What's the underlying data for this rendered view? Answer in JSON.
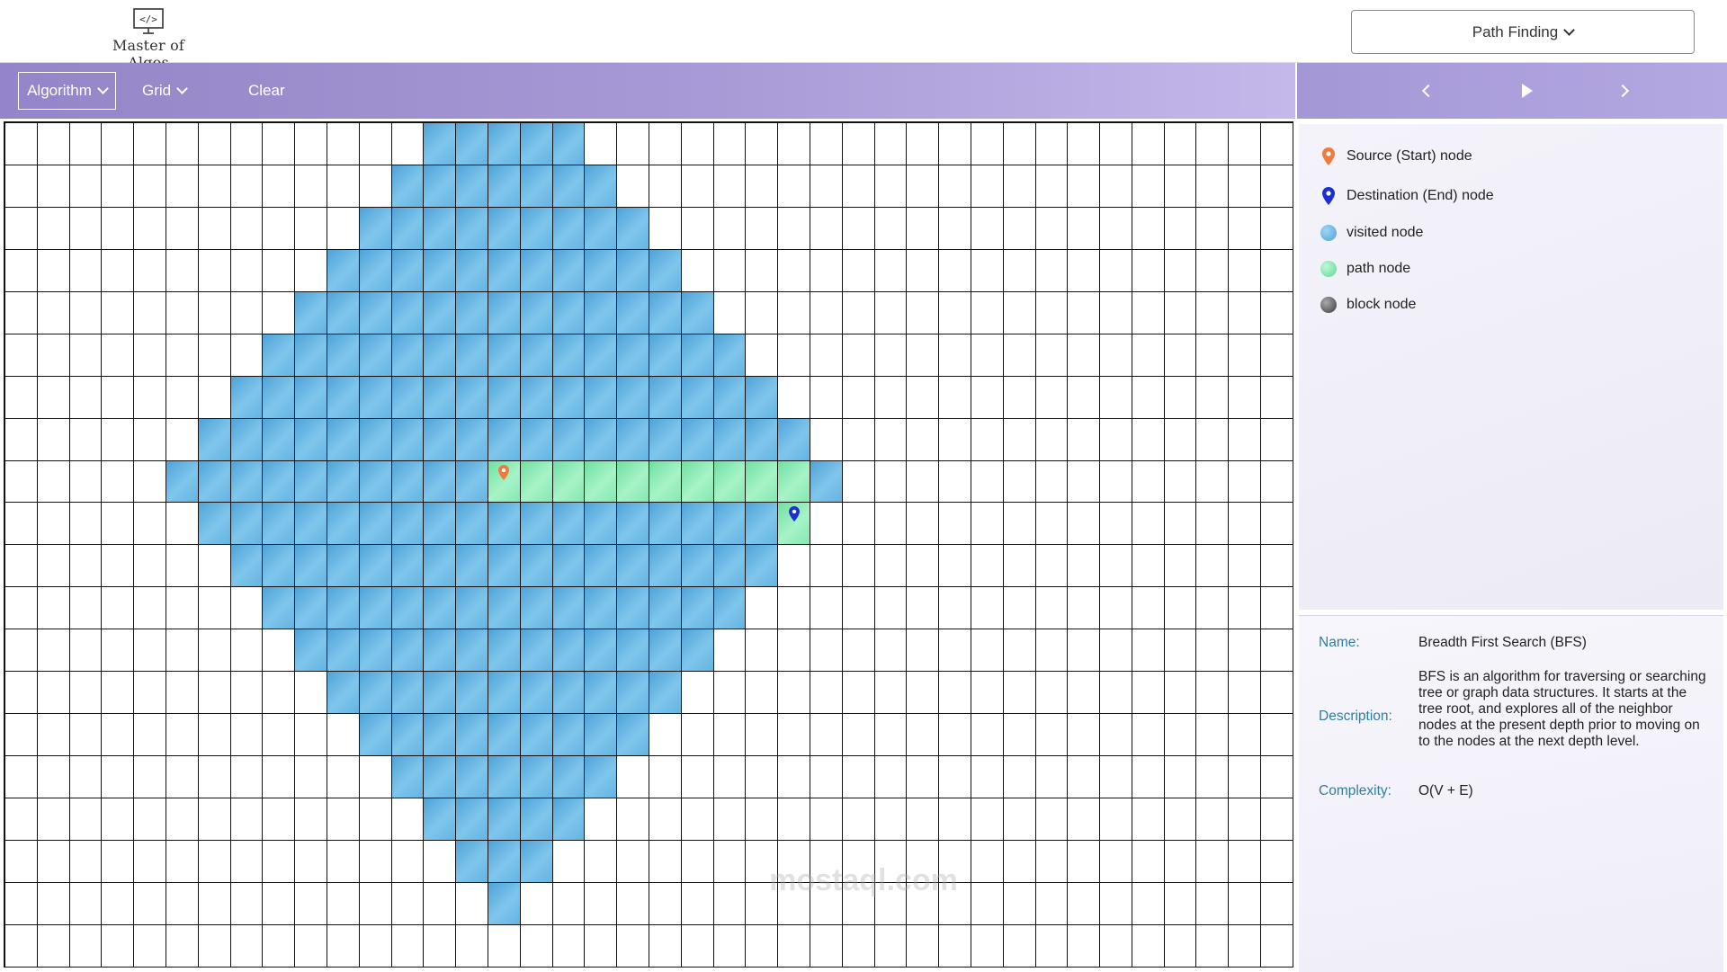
{
  "header": {
    "logo_text": "Master of Algos",
    "mode_label": "Path Finding"
  },
  "toolbar": {
    "algorithm_label": "Algorithm",
    "grid_label": "Grid",
    "clear_label": "Clear"
  },
  "controls": {
    "prev_icon": "chevron-left-icon",
    "play_icon": "play-icon",
    "next_icon": "chevron-right-icon"
  },
  "legend": {
    "items": [
      {
        "label": "Source (Start) node",
        "icon": "map-pin-icon",
        "color": "#f07a3c"
      },
      {
        "label": "Destination (End) node",
        "icon": "map-pin-icon",
        "color": "#1a2fd6"
      },
      {
        "label": "visited node",
        "icon": "dot-icon",
        "color": "#5fb1e2"
      },
      {
        "label": "path node",
        "icon": "dot-icon",
        "color": "#6fe3a3"
      },
      {
        "label": "block node",
        "icon": "dot-icon",
        "color": "#555555"
      }
    ]
  },
  "info": {
    "name_label": "Name:",
    "name_value": "Breadth First Search (BFS)",
    "description_label": "Description:",
    "description_value": "BFS is an algorithm for traversing or searching tree or graph data structures. It starts at the tree root, and explores all of the neighbor nodes at the present depth prior to moving on to the nodes at the next depth level.",
    "complexity_label": "Complexity:",
    "complexity_value": "O(V + E)"
  },
  "watermark": "mostaql.com",
  "grid": {
    "rows": 20,
    "cols": 40,
    "source": [
      8,
      15
    ],
    "destination": [
      9,
      24
    ],
    "visited_radius": 10,
    "path": [
      [
        8,
        15
      ],
      [
        8,
        16
      ],
      [
        8,
        17
      ],
      [
        8,
        18
      ],
      [
        8,
        19
      ],
      [
        8,
        20
      ],
      [
        8,
        21
      ],
      [
        8,
        22
      ],
      [
        8,
        23
      ],
      [
        8,
        24
      ],
      [
        9,
        24
      ]
    ],
    "colors": {
      "visited": "#5fb1e2",
      "path": "#6fe3a3",
      "source": "#f07a3c",
      "destination": "#1a2fd6"
    }
  }
}
